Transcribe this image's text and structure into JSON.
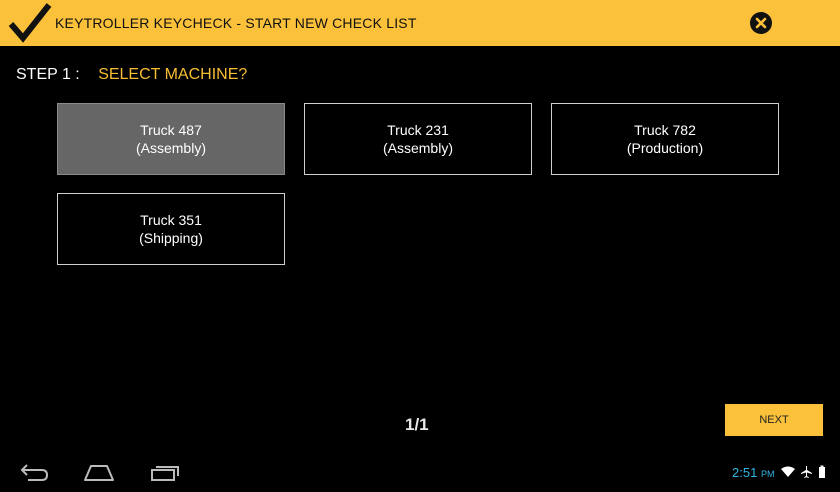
{
  "header": {
    "title": "KEYTROLLER KEYCHECK - START NEW CHECK LIST"
  },
  "step": {
    "label": "STEP 1 :",
    "title": "SELECT MACHINE?"
  },
  "machines": [
    {
      "name": "Truck 487",
      "dept": "(Assembly)",
      "selected": true
    },
    {
      "name": "Truck 231",
      "dept": "(Assembly)",
      "selected": false
    },
    {
      "name": "Truck 782",
      "dept": "(Production)",
      "selected": false
    },
    {
      "name": "Truck 351",
      "dept": "(Shipping)",
      "selected": false
    }
  ],
  "pager": "1/1",
  "next_label": "NEXT",
  "status_bar": {
    "time": "2:51",
    "ampm": "PM"
  },
  "colors": {
    "accent": "#FBC13A",
    "selected_tile": "#666666",
    "status_blue": "#33B5E5"
  }
}
